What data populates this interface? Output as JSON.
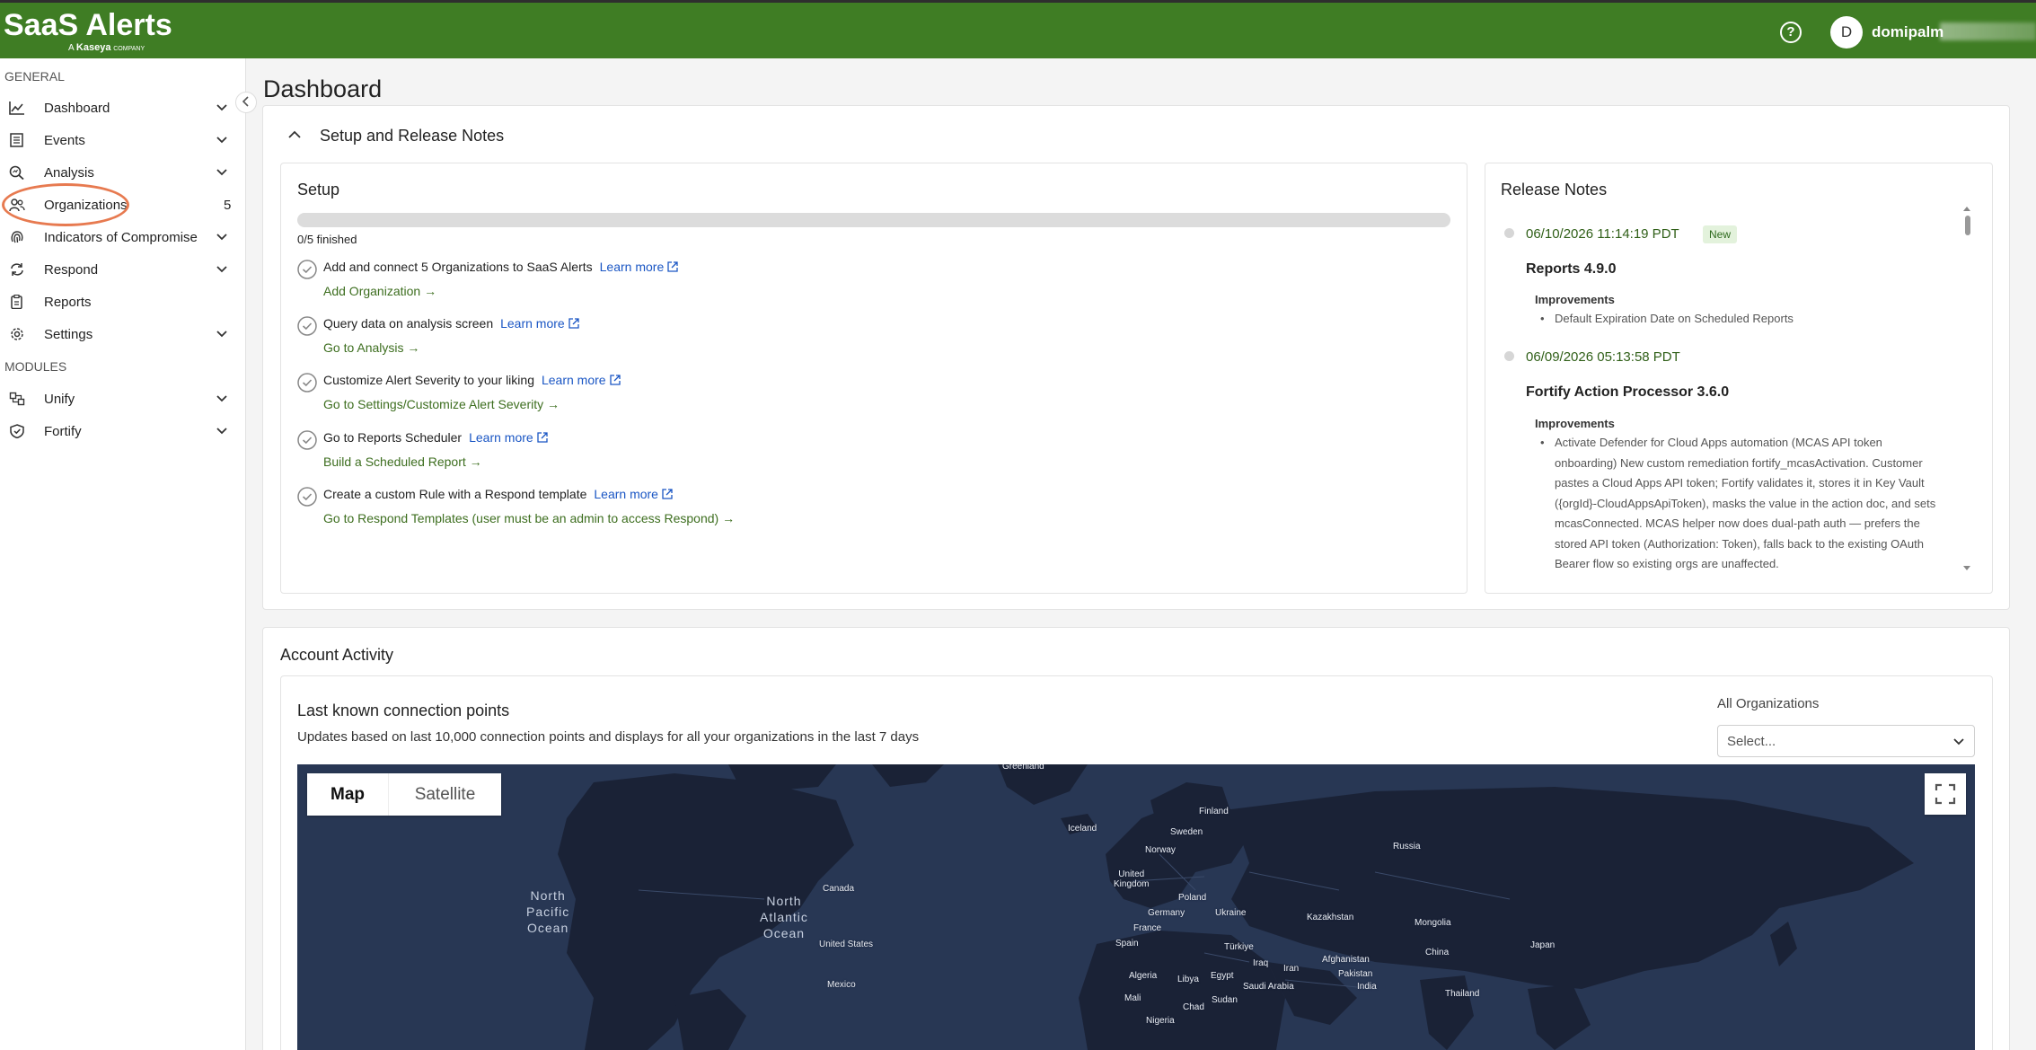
{
  "header": {
    "logo_main": "SaaS Alerts",
    "logo_sub_prefix": "A",
    "logo_sub_brand": "Kaseya",
    "logo_sub_suffix": "COMPANY",
    "help": "?",
    "avatar_initial": "D",
    "username": "domipalm"
  },
  "sidebar": {
    "general_title": "GENERAL",
    "modules_title": "MODULES",
    "items": [
      {
        "label": "Dashboard",
        "icon": "chart-line-icon"
      },
      {
        "label": "Events",
        "icon": "list-icon"
      },
      {
        "label": "Analysis",
        "icon": "magnify-chart-icon"
      },
      {
        "label": "Organizations",
        "icon": "users-icon",
        "count": "5"
      },
      {
        "label": "Indicators of Compromise",
        "icon": "fingerprint-icon"
      },
      {
        "label": "Respond",
        "icon": "refresh-icon"
      },
      {
        "label": "Reports",
        "icon": "clipboard-icon"
      },
      {
        "label": "Settings",
        "icon": "gear-icon"
      }
    ],
    "modules": [
      {
        "label": "Unify",
        "icon": "unify-icon"
      },
      {
        "label": "Fortify",
        "icon": "shield-icon"
      }
    ]
  },
  "main": {
    "title": "Dashboard",
    "setup_section_title": "Setup and Release Notes",
    "setup": {
      "title": "Setup",
      "progress_fraction": 0,
      "progress_text": "0/5 finished",
      "steps": [
        {
          "text": "Add and connect 5 Organizations to SaaS Alerts",
          "learn": "Learn more",
          "link": "Add Organization →"
        },
        {
          "text": "Query data on analysis screen",
          "learn": "Learn more",
          "link": "Go to Analysis →"
        },
        {
          "text": "Customize Alert Severity to your liking",
          "learn": "Learn more",
          "link": "Go to Settings/Customize Alert Severity →"
        },
        {
          "text": "Go to Reports Scheduler",
          "learn": "Learn more",
          "link": "Build a Scheduled Report →"
        },
        {
          "text": "Create a custom Rule with a Respond template",
          "learn": "Learn more",
          "link": "Go to Respond Templates (user must be an admin to access Respond) →"
        }
      ]
    },
    "release_notes": {
      "title": "Release Notes",
      "entries": [
        {
          "date": "06/10/2026 11:14:19 PDT",
          "badge": "New",
          "title": "Reports 4.9.0",
          "sub": "Improvements",
          "bullet": "Default Expiration Date on Scheduled Reports"
        },
        {
          "date": "06/09/2026 05:13:58 PDT",
          "title": "Fortify Action Processor 3.6.0",
          "sub": "Improvements",
          "bullet_lines": [
            "Activate Defender for Cloud Apps automation (MCAS API token",
            "onboarding) New custom remediation fortify_mcasActivation. Customer",
            "pastes a Cloud Apps API token; Fortify validates it, stores it in Key Vault",
            "({orgId}-CloudAppsApiToken), masks the value in the action doc, and sets",
            "mcasConnected. MCAS helper now does dual-path auth — prefers the",
            "stored API token (Authorization: Token), falls back to the existing OAuth",
            "Bearer flow so existing orgs are unaffected."
          ]
        }
      ]
    },
    "activity": {
      "title": "Account Activity",
      "map_title": "Last known connection points",
      "map_desc": "Updates based on last 10,000 connection points and displays for all your organizations in the last 7 days",
      "filter_label": "All Organizations",
      "filter_placeholder": "Select...",
      "map_btn": "Map",
      "satellite_btn": "Satellite",
      "oceans": [
        {
          "l1": "North",
          "l2": "Pacific",
          "l3": "Ocean"
        },
        {
          "l1": "North",
          "l2": "Atlantic",
          "l3": "Ocean"
        }
      ],
      "labels": {
        "greenland": "Greenland",
        "iceland": "Iceland",
        "finland": "Finland",
        "sweden": "Sweden",
        "norway": "Norway",
        "russia": "Russia",
        "canada": "Canada",
        "uk1": "United",
        "uk2": "Kingdom",
        "poland": "Poland",
        "germany": "Germany",
        "ukraine": "Ukraine",
        "kazakhstan": "Kazakhstan",
        "mongolia": "Mongolia",
        "france": "France",
        "us": "United States",
        "spain": "Spain",
        "turkiye": "Türkiye",
        "china": "China",
        "japan": "Japan",
        "iraq": "Iraq",
        "iran": "Iran",
        "afghanistan": "Afghanistan",
        "pakistan": "Pakistan",
        "mexico": "Mexico",
        "algeria": "Algeria",
        "libya": "Libya",
        "egypt": "Egypt",
        "saudi": "Saudi Arabia",
        "india": "India",
        "thailand": "Thailand",
        "mali": "Mali",
        "sudan": "Sudan",
        "chad": "Chad",
        "nigeria": "Nigeria"
      }
    }
  },
  "colors": {
    "brand_green": "#3f7d24",
    "link_green": "#3d6e1f",
    "link_blue": "#1a56c4",
    "map_bg": "#283754",
    "highlight": "#e77a50"
  }
}
